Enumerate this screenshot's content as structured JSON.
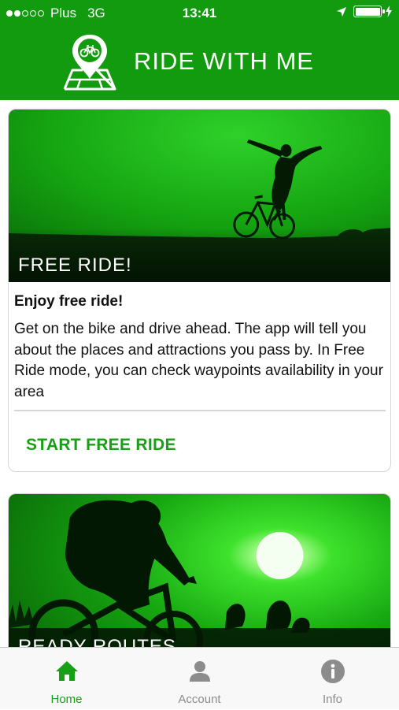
{
  "status_bar": {
    "carrier": "Plus",
    "network": "3G",
    "time": "13:41"
  },
  "header": {
    "title": "RIDE WITH ME",
    "logo_icon": "map-pin-bicycle-icon",
    "background_color": "#129b0f"
  },
  "cards": [
    {
      "image_title": "FREE RIDE!",
      "heading": "Enjoy free ride!",
      "body": "Get on the bike and drive ahead. The app will tell you about the places and attractions you pass by. In Free Ride mode, you can check waypoints availability in your area",
      "action_label": "START FREE RIDE"
    },
    {
      "image_title": "READY ROUTES"
    }
  ],
  "tabbar": {
    "items": [
      {
        "label": "Home",
        "icon": "home-icon",
        "active": true
      },
      {
        "label": "Account",
        "icon": "person-icon",
        "active": false
      },
      {
        "label": "Info",
        "icon": "info-icon",
        "active": false
      }
    ]
  },
  "colors": {
    "accent": "#17a015",
    "inactive": "#8c8c8c"
  }
}
